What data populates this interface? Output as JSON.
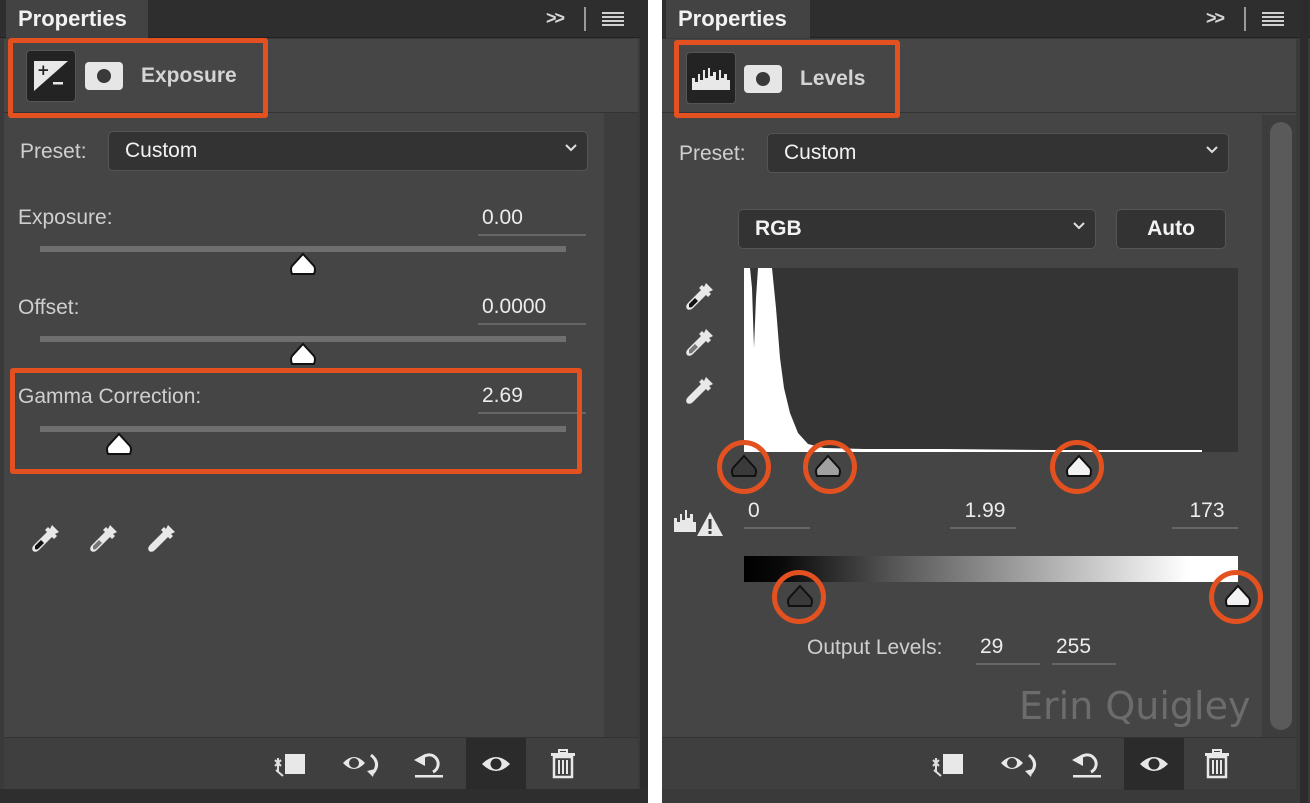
{
  "accent_color": "#e2511f",
  "left_panel": {
    "tab_label": "Properties",
    "collapse_icon": "double-chevron-right-icon",
    "menu_icon": "hamburger-menu-icon",
    "adjustment_icon": "exposure-icon",
    "mask_icon": "layer-mask-icon",
    "adjustment_title": "Exposure",
    "preset_label": "Preset:",
    "preset_value": "Custom",
    "sliders": [
      {
        "label": "Exposure:",
        "value": "0.00",
        "position_fraction": 0.5
      },
      {
        "label": "Offset:",
        "value": "0.0000",
        "position_fraction": 0.5
      },
      {
        "label": "Gamma Correction:",
        "value": "2.69",
        "position_fraction": 0.15
      }
    ],
    "eyedroppers": [
      "black-point-eyedropper-icon",
      "gray-point-eyedropper-icon",
      "white-point-eyedropper-icon"
    ],
    "footer_buttons": [
      {
        "name": "clip-to-layer-button",
        "icon": "clip-to-layer-icon"
      },
      {
        "name": "view-previous-state-button",
        "icon": "eye-cycle-icon"
      },
      {
        "name": "reset-button",
        "icon": "reset-icon"
      },
      {
        "name": "toggle-visibility-button",
        "icon": "eye-icon"
      },
      {
        "name": "delete-button",
        "icon": "trash-icon"
      }
    ]
  },
  "right_panel": {
    "tab_label": "Properties",
    "collapse_icon": "double-chevron-right-icon",
    "menu_icon": "hamburger-menu-icon",
    "adjustment_icon": "levels-histogram-icon",
    "mask_icon": "layer-mask-icon",
    "adjustment_title": "Levels",
    "preset_label": "Preset:",
    "preset_value": "Custom",
    "channel_value": "RGB",
    "auto_label": "Auto",
    "input_levels": {
      "black": "0",
      "gamma": "1.99",
      "white": "173"
    },
    "input_slider_fractions": {
      "black": 0.0,
      "gamma": 0.17,
      "white": 0.678
    },
    "output_levels_label": "Output Levels:",
    "output_levels": {
      "black": "29",
      "white": "255"
    },
    "output_slider_fractions": {
      "black": 0.114,
      "white": 1.0
    },
    "watermark": "Erin Quigley",
    "footer_buttons": [
      {
        "name": "clip-to-layer-button",
        "icon": "clip-to-layer-icon"
      },
      {
        "name": "view-previous-state-button",
        "icon": "eye-cycle-icon"
      },
      {
        "name": "reset-button",
        "icon": "reset-icon"
      },
      {
        "name": "toggle-visibility-button",
        "icon": "eye-icon"
      },
      {
        "name": "delete-button",
        "icon": "trash-icon"
      }
    ]
  }
}
